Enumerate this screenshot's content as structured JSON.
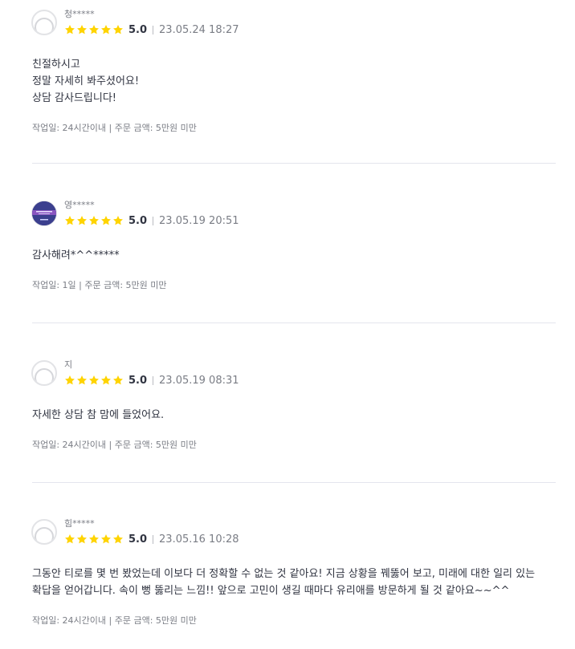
{
  "reviews": [
    {
      "nickname": "청*****",
      "score": "5.0",
      "date": "23.05.24 18:27",
      "content": "친절하시고\n정말 자세히 봐주셨어요!\n상담 감사드립니다!",
      "meta": "작업일: 24시간이내 | 주문 금액: 5만원 미만",
      "avatar": "default-avatar-icon"
    },
    {
      "nickname": "영*****",
      "score": "5.0",
      "date": "23.05.19 20:51",
      "content": "감사해려*^^*****",
      "meta": "작업일: 1일 | 주문 금액: 5만원 미만",
      "avatar": "profile-photo"
    },
    {
      "nickname": "지",
      "score": "5.0",
      "date": "23.05.19 08:31",
      "content": "자세한 상담 참 맘에 들었어요.",
      "meta": "작업일: 24시간이내 | 주문 금액: 5만원 미만",
      "avatar": "default-avatar-icon"
    },
    {
      "nickname": "힘*****",
      "score": "5.0",
      "date": "23.05.16 10:28",
      "content": "그동안 티로를 몇 번 봤었는데 이보다 더 정확할 수 없는 것 같아요! 지금 상황을 꿰뚫어 보고, 미래에 대한 일리 있는 확답을 얻어갑니다. 속이 뻥 뚫리는 느낌!! 앞으로 고민이 생길 때마다 유리애를 방문하게 될 것 같아요~~^^",
      "meta": "작업일: 24시간이내 | 주문 금액: 5만원 미만",
      "avatar": "default-avatar-icon"
    }
  ],
  "colors": {
    "star": "#FFD400",
    "text": "#303441",
    "muted": "#7a7d85",
    "divider": "#e4e5ed"
  }
}
